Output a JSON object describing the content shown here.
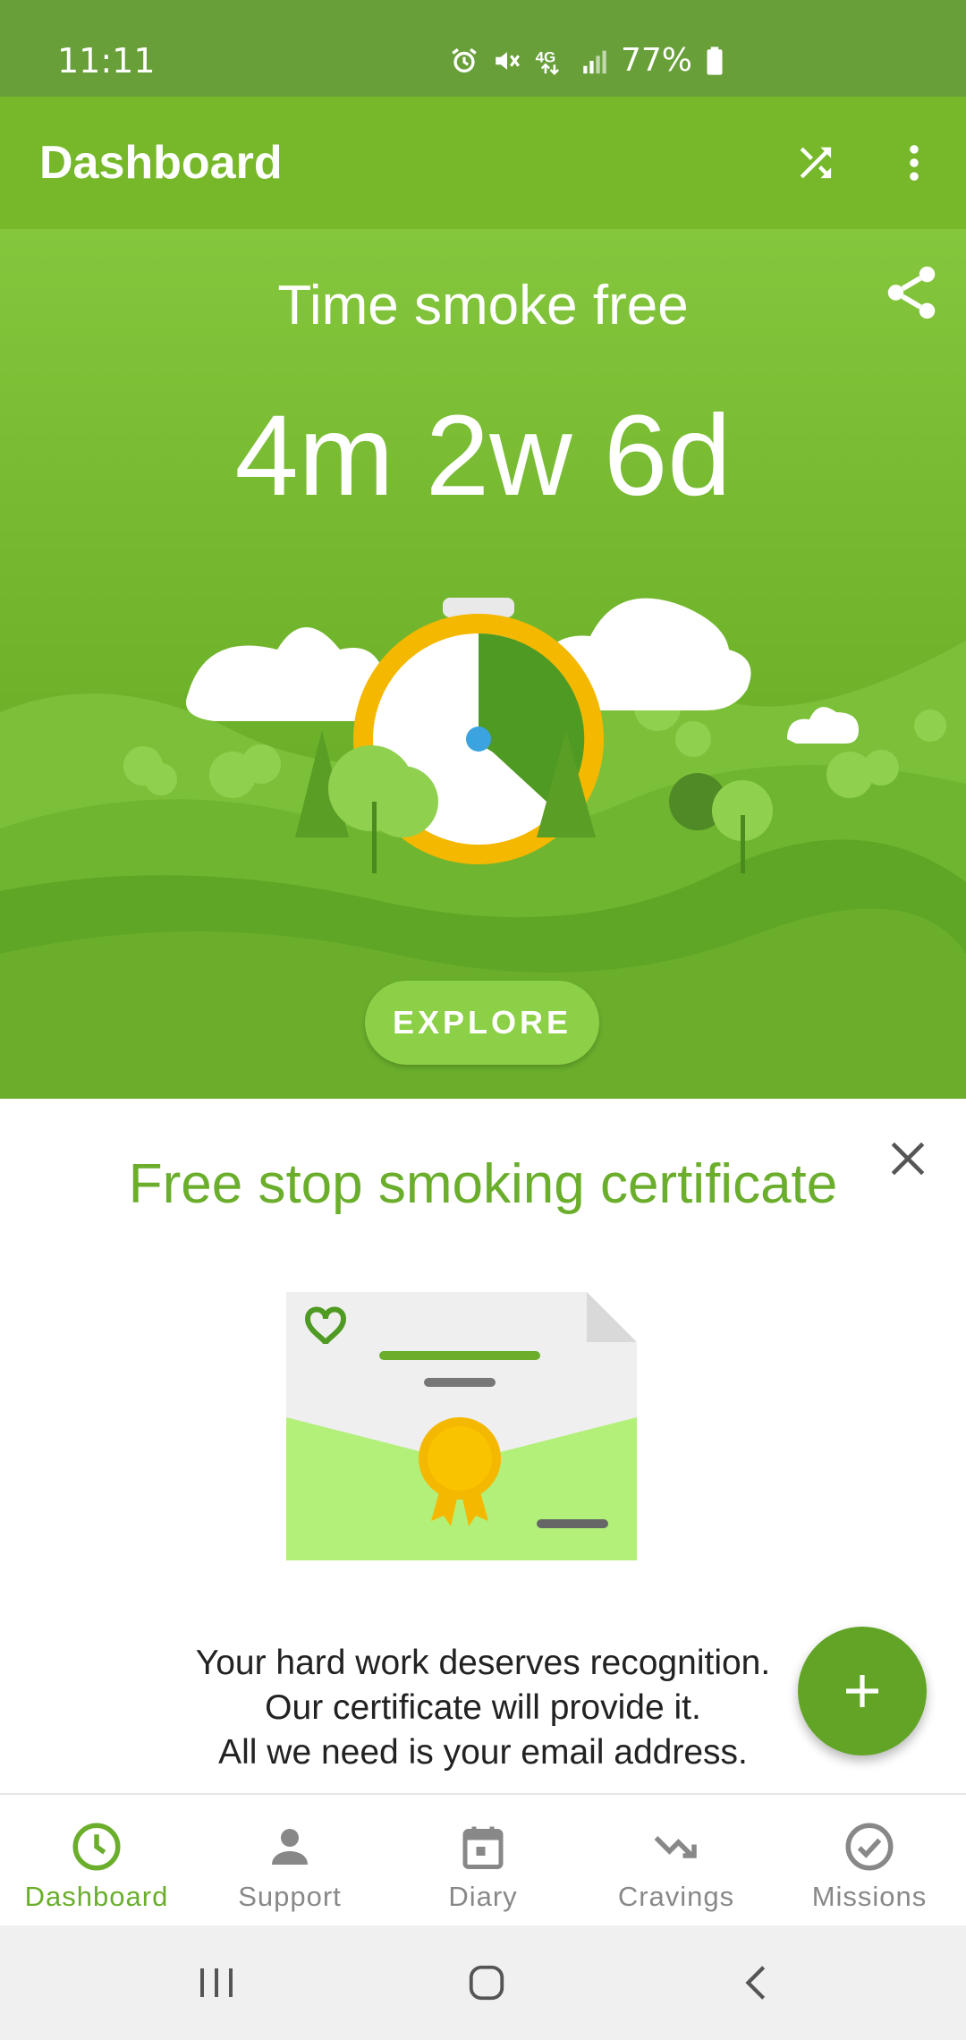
{
  "status_bar": {
    "time": "11:11",
    "battery": "77%"
  },
  "app_bar": {
    "title": "Dashboard"
  },
  "hero": {
    "label": "Time smoke free",
    "value": "4m 2w 6d",
    "explore_label": "EXPLORE"
  },
  "certificate_card": {
    "title": "Free stop smoking certificate",
    "message_lines": [
      "Your hard work deserves recognition.",
      "Our certificate will provide it.",
      "All we need is your email address."
    ]
  },
  "bottom_nav": {
    "items": [
      {
        "label": "Dashboard",
        "icon": "clock-icon",
        "active": true
      },
      {
        "label": "Support",
        "icon": "person-icon",
        "active": false
      },
      {
        "label": "Diary",
        "icon": "calendar-icon",
        "active": false
      },
      {
        "label": "Cravings",
        "icon": "trend-down-icon",
        "active": false
      },
      {
        "label": "Missions",
        "icon": "check-circle-icon",
        "active": false
      }
    ]
  },
  "colors": {
    "primary": "#76b82a",
    "status_bar": "#689f38",
    "accent": "#6aae2c",
    "fab": "#62a425"
  }
}
